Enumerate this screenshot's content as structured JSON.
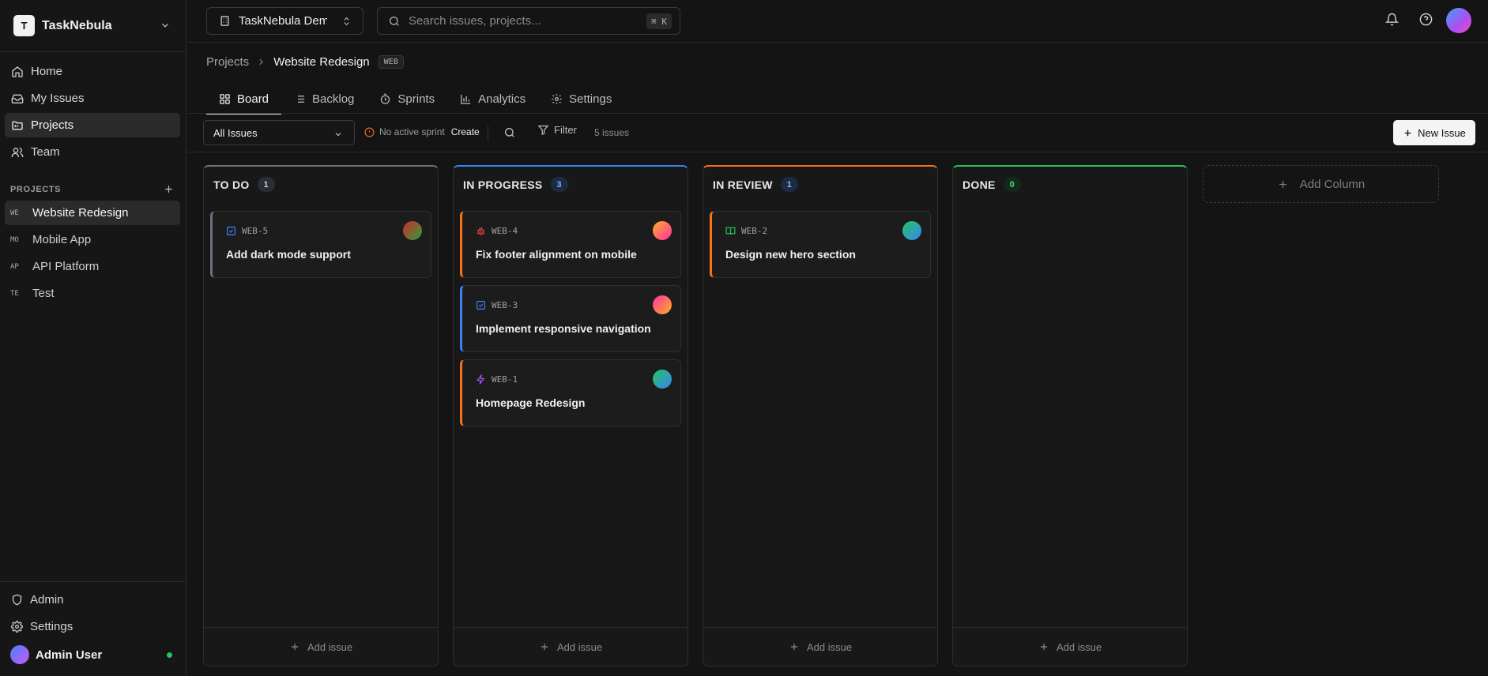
{
  "workspace": {
    "logo_letter": "T",
    "name": "TaskNebula"
  },
  "nav": [
    {
      "label": "Home",
      "icon": "home-icon"
    },
    {
      "label": "My Issues",
      "icon": "inbox-icon"
    },
    {
      "label": "Projects",
      "icon": "folder-icon",
      "active": true
    },
    {
      "label": "Team",
      "icon": "users-icon"
    }
  ],
  "projects_section": {
    "heading": "PROJECTS",
    "items": [
      {
        "abbr": "WE",
        "label": "Website Redesign",
        "active": true
      },
      {
        "abbr": "MO",
        "label": "Mobile App"
      },
      {
        "abbr": "AP",
        "label": "API Platform"
      },
      {
        "abbr": "TE",
        "label": "Test"
      }
    ]
  },
  "sidebar_bottom": {
    "admin_label": "Admin",
    "settings_label": "Settings",
    "user_name": "Admin User"
  },
  "topbar": {
    "org_name": "TaskNebula Demo",
    "search_placeholder": "Search issues, projects...",
    "shortcut": "⌘ K"
  },
  "breadcrumb": {
    "parent": "Projects",
    "current": "Website Redesign",
    "key": "WEB"
  },
  "tabs": [
    {
      "label": "Board",
      "icon": "board-icon",
      "active": true
    },
    {
      "label": "Backlog",
      "icon": "list-icon"
    },
    {
      "label": "Sprints",
      "icon": "timer-icon"
    },
    {
      "label": "Analytics",
      "icon": "bar-chart-icon"
    },
    {
      "label": "Settings",
      "icon": "gear-icon"
    }
  ],
  "toolbar": {
    "issue_filter": "All Issues",
    "sprint_warning": "No active sprint",
    "create_label": "Create",
    "filter_label": "Filter",
    "issue_count": "5 issues",
    "new_issue_label": "New Issue"
  },
  "columns": [
    {
      "title": "TO DO",
      "count": "1",
      "accent": "#6b7280",
      "count_bg": "#2a2d33",
      "count_color": "#c9ccd2",
      "add_label": "Add issue",
      "cards": [
        {
          "key": "WEB-5",
          "title": "Add dark mode support",
          "type": "task",
          "border": "#6b7280",
          "avatar": "linear-gradient(135deg,#d02a2a,#2f9e3a)"
        }
      ]
    },
    {
      "title": "IN PROGRESS",
      "count": "3",
      "accent": "#3b82f6",
      "count_bg": "#1c2a44",
      "count_color": "#7fb0ff",
      "add_label": "Add issue",
      "cards": [
        {
          "key": "WEB-4",
          "title": "Fix footer alignment on mobile",
          "type": "bug",
          "border": "#f97316",
          "avatar": "linear-gradient(135deg,#ffb020,#ff2fa6)"
        },
        {
          "key": "WEB-3",
          "title": "Implement responsive navigation",
          "type": "task",
          "border": "#3b82f6",
          "avatar": "linear-gradient(135deg,#ff2fa6,#ffb020)"
        },
        {
          "key": "WEB-1",
          "title": "Homepage Redesign",
          "type": "epic",
          "border": "#f97316",
          "avatar": "linear-gradient(135deg,#22c55e,#3b82f6)"
        }
      ]
    },
    {
      "title": "IN REVIEW",
      "count": "1",
      "accent": "#f97316",
      "count_bg": "#1c2a44",
      "count_color": "#7fb0ff",
      "add_label": "Add issue",
      "cards": [
        {
          "key": "WEB-2",
          "title": "Design new hero section",
          "type": "story",
          "border": "#f97316",
          "avatar": "linear-gradient(135deg,#22c55e,#3b82f6)"
        }
      ]
    },
    {
      "title": "DONE",
      "count": "0",
      "accent": "#22c55e",
      "count_bg": "#13291c",
      "count_color": "#4ade80",
      "add_label": "Add issue",
      "cards": []
    }
  ],
  "add_column_label": "Add Column",
  "colors": {
    "task_icon": "#3b82f6",
    "bug_icon": "#ef4444",
    "epic_icon": "#a855f7",
    "story_icon": "#22c55e",
    "warning": "#f97316"
  }
}
